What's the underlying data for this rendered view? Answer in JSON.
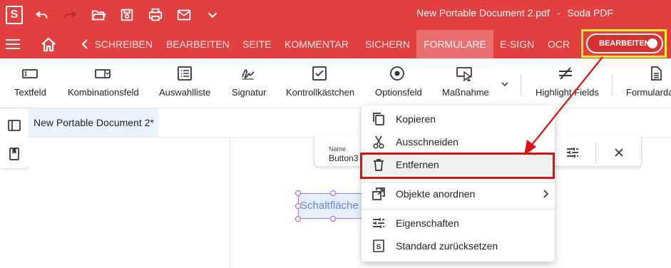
{
  "titlebar": {
    "logo": "S",
    "document_name": "New Portable Document 2.pdf",
    "separator": "-",
    "app_name": "Soda PDF",
    "quick_access_icons": [
      "undo-icon",
      "redo-icon",
      "open-folder-icon",
      "save-icon",
      "print-icon",
      "mail-icon",
      "chevron-down-icon"
    ]
  },
  "menubar": {
    "tabs": [
      "SCHREIBEN",
      "BEARBEITEN",
      "SEITE",
      "KOMMENTAR",
      "SICHERN",
      "FORMULARE",
      "E-SIGN",
      "OCR"
    ],
    "active_tab": "FORMULARE",
    "edit_toggle_label": "BEARBEITEN"
  },
  "ribbon": {
    "tools": [
      "Textfeld",
      "Kombinationsfeld",
      "Auswahlliste",
      "Signatur",
      "Kontrollkästchen",
      "Optionsfeld",
      "Maßnahme",
      "Highlight Fields",
      "Formularda"
    ]
  },
  "document": {
    "tab_title": "New Portable Document 2*",
    "field_name_label": "Name",
    "field_name_value": "Button3",
    "button_text": "Schaltfläche"
  },
  "context_menu": {
    "items": [
      "Kopieren",
      "Ausschneiden",
      "Entfernen",
      "Objekte anordnen",
      "Eigenschaften",
      "Standard zurücksetzen"
    ],
    "highlighted": "Entfernen"
  },
  "colors": {
    "brand_red": "#e1403f",
    "active_tab": "#eb6f6f",
    "highlight_yellow": "#f5ec32",
    "annotation_red": "#e01010"
  }
}
